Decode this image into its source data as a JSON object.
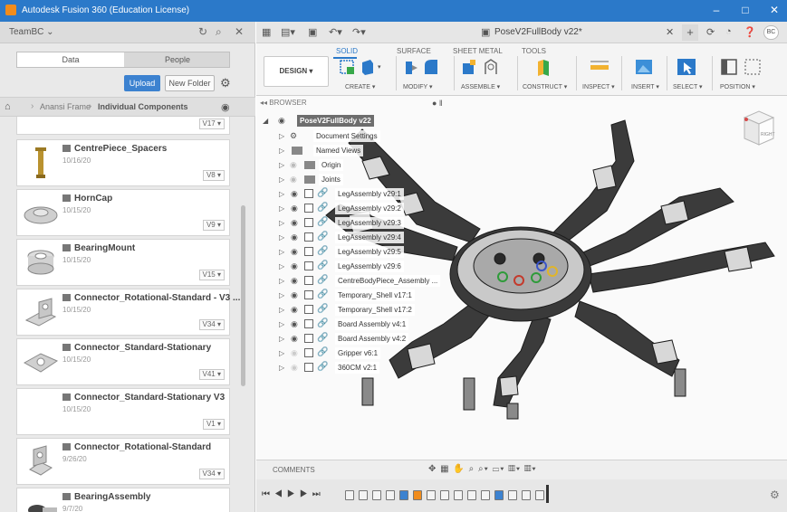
{
  "titlebar": {
    "title": "Autodesk Fusion 360 (Education License)",
    "minimize": "–",
    "maximize": "□",
    "close": "✕"
  },
  "data_panel": {
    "team": "TeamBC ⌄",
    "tabs": [
      "Data",
      "People"
    ],
    "upload_label": "Upload",
    "new_folder_label": "New Folder",
    "breadcrumb": [
      "Anansi Frame",
      "Individual Components"
    ],
    "files": [
      {
        "name": "",
        "date": "",
        "version": "V17 ▾"
      },
      {
        "name": "CentrePiece_Spacers",
        "date": "10/16/20",
        "version": "V8 ▾"
      },
      {
        "name": "HornCap",
        "date": "10/15/20",
        "version": "V9 ▾"
      },
      {
        "name": "BearingMount",
        "date": "10/15/20",
        "version": "V15 ▾"
      },
      {
        "name": "Connector_Rotational-Standard - V3 ...",
        "date": "10/15/20",
        "version": "V34 ▾"
      },
      {
        "name": "Connector_Standard-Stationary",
        "date": "10/15/20",
        "version": "V41 ▾"
      },
      {
        "name": "Connector_Standard-Stationary V3",
        "date": "10/15/20",
        "version": "V1 ▾"
      },
      {
        "name": "Connector_Rotational-Standard",
        "date": "9/26/20",
        "version": "V34 ▾"
      },
      {
        "name": "BearingAssembly",
        "date": "9/7/20",
        "version": ""
      }
    ]
  },
  "document": {
    "title": "PoseV2FullBody v22*",
    "user_initials": "BC"
  },
  "ribbon": {
    "tabs": [
      "SOLID",
      "SURFACE",
      "SHEET METAL",
      "TOOLS"
    ],
    "active_tab": "SOLID",
    "workspace": "DESIGN ▾",
    "groups": [
      "CREATE ▾",
      "MODIFY ▾",
      "ASSEMBLE ▾",
      "CONSTRUCT ▾",
      "INSPECT ▾",
      "INSERT ▾",
      "SELECT ▾",
      "POSITION ▾"
    ]
  },
  "browser": {
    "header": "BROWSER",
    "root": "PoseV2FullBody v22",
    "items": [
      "Document Settings",
      "Named Views",
      "Origin",
      "Joints",
      "LegAssembly v29:1",
      "LegAssembly v29:2",
      "LegAssembly v29:3",
      "LegAssembly v29:4",
      "LegAssembly v29:5",
      "LegAssembly v29:6",
      "CentreBodyPiece_Assembly ...",
      "Temporary_Shell v17:1",
      "Temporary_Shell v17:2",
      "Board Assembly v4:1",
      "Board Assembly v4:2",
      "Gripper v6:1",
      "360CM v2:1"
    ]
  },
  "viewcube": {
    "face": "RIGHT"
  },
  "comments": {
    "label": "COMMENTS"
  },
  "colors": {
    "accent": "#2b79c9",
    "titlebar": "#2b79c9"
  }
}
